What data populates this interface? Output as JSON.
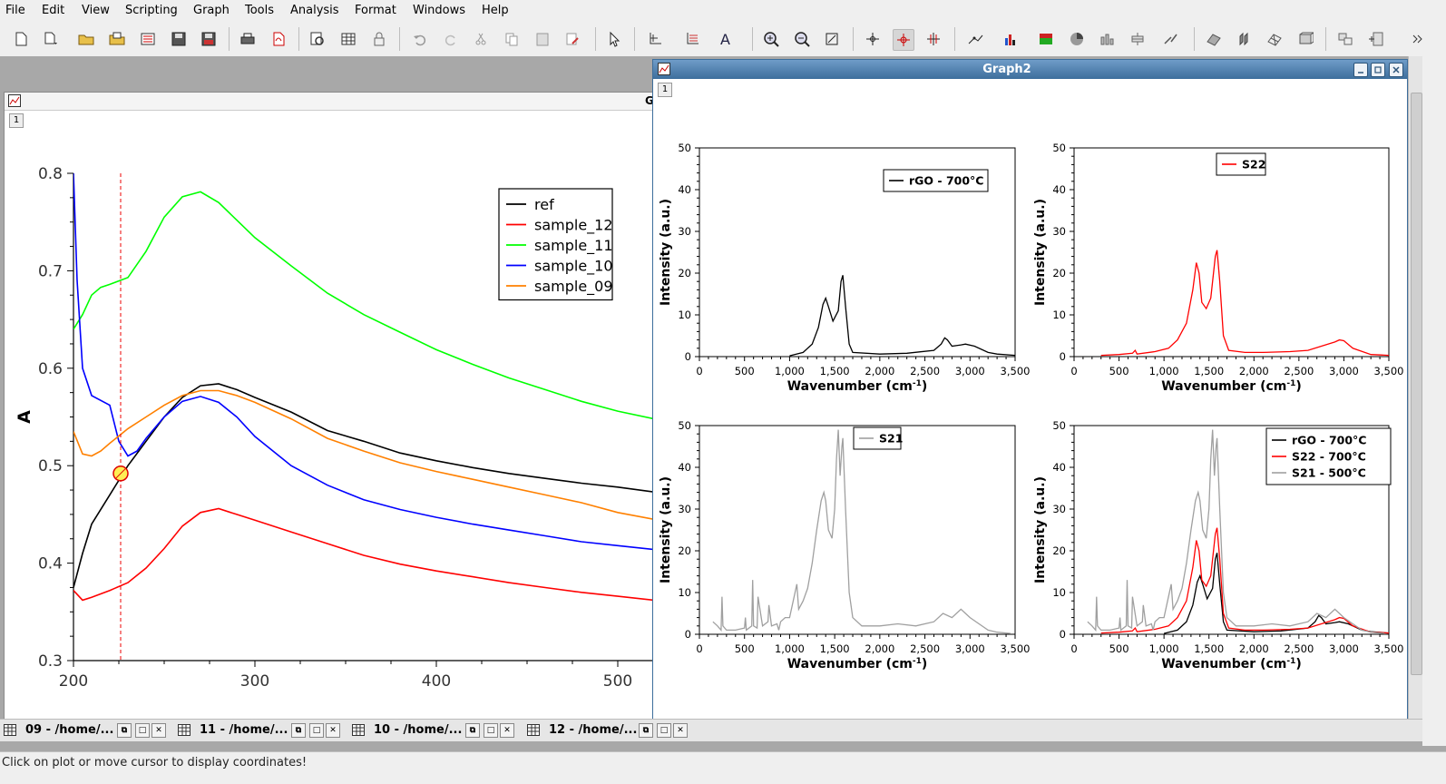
{
  "menu": [
    "File",
    "Edit",
    "View",
    "Scripting",
    "Graph",
    "Tools",
    "Analysis",
    "Format",
    "Windows",
    "Help"
  ],
  "toolbar": {
    "icons": [
      "new-project-icon",
      "new-dropdown-icon",
      "open-folder-icon",
      "open-template-icon",
      "import-ascii-icon",
      "save-icon",
      "save-as-icon",
      "print-icon",
      "export-pdf-icon",
      "preview-icon",
      "table-icon",
      "lock-icon",
      "undo-icon",
      "redo-icon",
      "cut-icon",
      "copy-icon",
      "paste-icon",
      "clear-icon",
      "pointer-icon",
      "axes-dropdown-icon",
      "grid-dropdown-icon",
      "text-dropdown-icon",
      "zoom-in-icon",
      "zoom-out-icon",
      "rescale-icon",
      "data-reader-icon",
      "screen-reader-icon",
      "data-range-icon",
      "line-style-dropdown-icon",
      "bar-chart-dropdown-icon",
      "image-plot-icon",
      "pie-icon",
      "3d-bars-icon",
      "box-plot-icon",
      "vector-dropdown-icon",
      "3d-surface-icon",
      "3d-ribbon-icon",
      "3d-wireframe-icon",
      "3d-scatter-icon",
      "arrange-layers-icon",
      "add-layer-icon"
    ]
  },
  "graph1": {
    "title_partial": "G",
    "layer": "1",
    "y_axis_label": "A",
    "chart_data": {
      "type": "line",
      "xlabel": "",
      "ylabel": "A",
      "xlim": [
        200,
        520
      ],
      "ylim": [
        0.3,
        0.8
      ],
      "x_ticks": [
        "200",
        "300",
        "400",
        "500"
      ],
      "y_ticks": [
        "0.3",
        "0.4",
        "0.5",
        "0.6",
        "0.7",
        "0.8"
      ],
      "legend_position": "top-right",
      "cursor_x": 226,
      "marker_point": [
        226,
        0.492
      ],
      "series": [
        {
          "name": "ref",
          "color": "#000000",
          "x": [
            200,
            205,
            210,
            220,
            230,
            240,
            250,
            260,
            270,
            280,
            290,
            300,
            320,
            340,
            360,
            380,
            400,
            420,
            440,
            460,
            480,
            500,
            520
          ],
          "y": [
            0.375,
            0.41,
            0.44,
            0.47,
            0.5,
            0.525,
            0.55,
            0.57,
            0.582,
            0.584,
            0.578,
            0.57,
            0.555,
            0.536,
            0.525,
            0.513,
            0.505,
            0.498,
            0.492,
            0.487,
            0.482,
            0.478,
            0.473
          ]
        },
        {
          "name": "sample_12",
          "color": "#ff0000",
          "x": [
            200,
            205,
            210,
            220,
            230,
            240,
            250,
            260,
            270,
            280,
            290,
            300,
            320,
            340,
            360,
            380,
            400,
            420,
            440,
            460,
            480,
            500,
            520
          ],
          "y": [
            0.372,
            0.362,
            0.365,
            0.372,
            0.38,
            0.395,
            0.415,
            0.438,
            0.452,
            0.456,
            0.45,
            0.444,
            0.432,
            0.42,
            0.408,
            0.399,
            0.392,
            0.386,
            0.38,
            0.375,
            0.37,
            0.366,
            0.362
          ]
        },
        {
          "name": "sample_11",
          "color": "#00ff00",
          "x": [
            200,
            205,
            210,
            215,
            220,
            230,
            240,
            250,
            260,
            270,
            280,
            290,
            300,
            320,
            340,
            360,
            380,
            400,
            420,
            440,
            460,
            480,
            500,
            520
          ],
          "y": [
            0.64,
            0.655,
            0.675,
            0.683,
            0.686,
            0.693,
            0.72,
            0.755,
            0.776,
            0.781,
            0.77,
            0.752,
            0.734,
            0.705,
            0.677,
            0.655,
            0.637,
            0.619,
            0.604,
            0.59,
            0.578,
            0.566,
            0.556,
            0.548
          ]
        },
        {
          "name": "sample_10",
          "color": "#0000ff",
          "x": [
            200,
            202,
            205,
            210,
            220,
            225,
            230,
            235,
            240,
            250,
            260,
            270,
            280,
            290,
            300,
            320,
            340,
            360,
            380,
            400,
            420,
            440,
            460,
            480,
            500,
            520
          ],
          "y": [
            0.8,
            0.69,
            0.6,
            0.572,
            0.562,
            0.525,
            0.51,
            0.515,
            0.528,
            0.55,
            0.566,
            0.571,
            0.565,
            0.55,
            0.53,
            0.5,
            0.48,
            0.465,
            0.455,
            0.447,
            0.44,
            0.434,
            0.428,
            0.422,
            0.418,
            0.414
          ]
        },
        {
          "name": "sample_09",
          "color": "#ff8000",
          "x": [
            200,
            205,
            210,
            215,
            220,
            230,
            240,
            250,
            260,
            270,
            280,
            290,
            300,
            320,
            340,
            360,
            380,
            400,
            420,
            440,
            460,
            480,
            500,
            520
          ],
          "y": [
            0.535,
            0.512,
            0.51,
            0.515,
            0.523,
            0.538,
            0.55,
            0.562,
            0.572,
            0.577,
            0.577,
            0.572,
            0.565,
            0.548,
            0.528,
            0.515,
            0.503,
            0.494,
            0.486,
            0.478,
            0.47,
            0.462,
            0.452,
            0.445
          ]
        }
      ]
    }
  },
  "graph2": {
    "title": "Graph2",
    "layer": "1",
    "chart_data": [
      {
        "type": "line",
        "xlabel": "Wavenumber",
        "xlabel_unit": "(cm",
        "xlabel_sup": "-1",
        "xlabel_tail": ")",
        "ylabel": "Intensity (a.u.)",
        "xlim": [
          0,
          3500
        ],
        "ylim": [
          0,
          50
        ],
        "x_ticks": [
          "0",
          "500",
          "1,000",
          "1,500",
          "2,000",
          "2,500",
          "3,000",
          "3,500"
        ],
        "y_ticks": [
          "0",
          "10",
          "20",
          "30",
          "40",
          "50"
        ],
        "legend_position": "top-right",
        "series": [
          {
            "name": "rGO - 700°C",
            "color": "#000000",
            "x": [
              1000,
              1150,
              1250,
              1320,
              1370,
              1400,
              1430,
              1480,
              1540,
              1570,
              1590,
              1620,
              1660,
              1700,
              2000,
              2300,
              2600,
              2680,
              2720,
              2750,
              2800,
              2900,
              2950,
              3050,
              3200,
              3300,
              3500
            ],
            "y": [
              0.2,
              1,
              3,
              7,
              12.5,
              14,
              12,
              8.5,
              11,
              18,
              19.5,
              12,
              3,
              1,
              0.6,
              0.8,
              1.5,
              3,
              4.5,
              4,
              2.5,
              2.8,
              3,
              2.5,
              1,
              0.6,
              0.3
            ]
          }
        ]
      },
      {
        "type": "line",
        "xlabel": "Wavenumber",
        "xlabel_unit": "(cm",
        "xlabel_sup": "-1",
        "xlabel_tail": ")",
        "ylabel": "Intensity (a.u.)",
        "xlim": [
          0,
          3500
        ],
        "ylim": [
          0,
          50
        ],
        "x_ticks": [
          "0",
          "500",
          "1,000",
          "1,500",
          "2,000",
          "2,500",
          "3,000",
          "3,500"
        ],
        "y_ticks": [
          "0",
          "10",
          "20",
          "30",
          "40",
          "50"
        ],
        "legend_position": "top-center",
        "series": [
          {
            "name": "S22",
            "color": "#ff0000",
            "x": [
              300,
              500,
              650,
              680,
              700,
              900,
              1050,
              1150,
              1250,
              1320,
              1360,
              1390,
              1420,
              1470,
              1520,
              1570,
              1590,
              1620,
              1660,
              1720,
              1900,
              2100,
              2400,
              2600,
              2750,
              2900,
              2950,
              3000,
              3100,
              3300,
              3500
            ],
            "y": [
              0.3,
              0.5,
              0.8,
              1.5,
              0.6,
              1.2,
              2,
              4,
              8,
              16,
              22.5,
              20,
              13,
              11.5,
              14,
              24,
              25.5,
              18,
              5,
              1.5,
              1,
              1,
              1.2,
              1.5,
              2.5,
              3.5,
              4,
              3.8,
              2,
              0.5,
              0.3
            ]
          }
        ]
      },
      {
        "type": "line",
        "xlabel": "Wavenumber",
        "xlabel_unit": "(cm",
        "xlabel_sup": "-1",
        "xlabel_tail": ")",
        "ylabel": "Intensity (a.u.)",
        "xlim": [
          0,
          3500
        ],
        "ylim": [
          0,
          50
        ],
        "x_ticks": [
          "0",
          "500",
          "1,000",
          "1,500",
          "2,000",
          "2,500",
          "3,000",
          "3,500"
        ],
        "y_ticks": [
          "0",
          "10",
          "20",
          "30",
          "40",
          "50"
        ],
        "legend_position": "top-left",
        "series": [
          {
            "name": "S21",
            "color": "#a0a0a0",
            "x": [
              150,
              200,
              240,
              250,
              260,
              300,
              400,
              500,
              510,
              520,
              580,
              590,
              600,
              640,
              650,
              700,
              760,
              770,
              800,
              860,
              880,
              900,
              950,
              1000,
              1080,
              1100,
              1150,
              1200,
              1250,
              1300,
              1350,
              1380,
              1400,
              1430,
              1470,
              1500,
              1520,
              1540,
              1560,
              1580,
              1590,
              1620,
              1660,
              1700,
              1800,
              2000,
              2200,
              2400,
              2600,
              2700,
              2800,
              2900,
              2950,
              3000,
              3100,
              3200,
              3300,
              3400,
              3450
            ],
            "y": [
              3,
              2,
              1,
              9,
              2,
              1,
              1,
              1.5,
              4,
              1,
              2,
              13,
              2,
              1.5,
              9,
              2,
              3,
              7,
              2,
              2.5,
              1,
              3,
              4,
              4,
              12,
              6,
              8,
              11,
              17,
              25,
              32,
              34,
              32,
              25,
              23,
              30,
              42,
              49,
              38,
              45,
              47,
              30,
              10,
              4,
              2,
              2,
              2.5,
              2,
              3,
              5,
              4,
              6,
              5,
              4,
              2.5,
              1,
              0.5,
              0.3,
              0.2
            ]
          }
        ]
      },
      {
        "type": "line",
        "xlabel": "Wavenumber",
        "xlabel_unit": "(cm",
        "xlabel_sup": "-1",
        "xlabel_tail": ")",
        "ylabel": "Intensity (a.u.)",
        "xlim": [
          0,
          3500
        ],
        "ylim": [
          0,
          50
        ],
        "x_ticks": [
          "0",
          "500",
          "1,000",
          "1,500",
          "2,000",
          "2,500",
          "3,000",
          "3,500"
        ],
        "y_ticks": [
          "0",
          "10",
          "20",
          "30",
          "40",
          "50"
        ],
        "legend_position": "top-right",
        "series": [
          {
            "name": "rGO - 700°C",
            "color": "#000000",
            "x": [
              1000,
              1150,
              1250,
              1320,
              1370,
              1400,
              1430,
              1480,
              1540,
              1570,
              1590,
              1620,
              1660,
              1700,
              2000,
              2300,
              2600,
              2680,
              2720,
              2750,
              2800,
              2900,
              2950,
              3050,
              3200,
              3300,
              3500
            ],
            "y": [
              0.2,
              1,
              3,
              7,
              12.5,
              14,
              12,
              8.5,
              11,
              18,
              19.5,
              12,
              3,
              1,
              0.6,
              0.8,
              1.5,
              3,
              4.5,
              4,
              2.5,
              2.8,
              3,
              2.5,
              1,
              0.6,
              0.3
            ]
          },
          {
            "name": "S22 - 700°C",
            "color": "#ff0000",
            "x": [
              300,
              500,
              650,
              680,
              700,
              900,
              1050,
              1150,
              1250,
              1320,
              1360,
              1390,
              1420,
              1470,
              1520,
              1570,
              1590,
              1620,
              1660,
              1720,
              1900,
              2100,
              2400,
              2600,
              2750,
              2900,
              2950,
              3000,
              3100,
              3300,
              3500
            ],
            "y": [
              0.3,
              0.5,
              0.8,
              1.5,
              0.6,
              1.2,
              2,
              4,
              8,
              16,
              22.5,
              20,
              13,
              11.5,
              14,
              24,
              25.5,
              18,
              5,
              1.5,
              1,
              1,
              1.2,
              1.5,
              2.5,
              3.5,
              4,
              3.8,
              2,
              0.5,
              0.3
            ]
          },
          {
            "name": "S21 - 500°C",
            "color": "#a0a0a0",
            "x": [
              150,
              200,
              240,
              250,
              260,
              300,
              400,
              500,
              510,
              520,
              580,
              590,
              600,
              640,
              650,
              700,
              760,
              770,
              800,
              860,
              880,
              900,
              950,
              1000,
              1080,
              1100,
              1150,
              1200,
              1250,
              1300,
              1350,
              1380,
              1400,
              1430,
              1470,
              1500,
              1520,
              1540,
              1560,
              1580,
              1590,
              1620,
              1660,
              1700,
              1800,
              2000,
              2200,
              2400,
              2600,
              2700,
              2800,
              2900,
              2950,
              3000,
              3100,
              3200,
              3300,
              3400,
              3450
            ],
            "y": [
              3,
              2,
              1,
              9,
              2,
              1,
              1,
              1.5,
              4,
              1,
              2,
              13,
              2,
              1.5,
              9,
              2,
              3,
              7,
              2,
              2.5,
              1,
              3,
              4,
              4,
              12,
              6,
              8,
              11,
              17,
              25,
              32,
              34,
              32,
              25,
              23,
              30,
              42,
              49,
              38,
              45,
              47,
              30,
              10,
              4,
              2,
              2,
              2.5,
              2,
              3,
              5,
              4,
              6,
              5,
              4,
              2.5,
              1,
              0.5,
              0.3,
              0.2
            ]
          }
        ]
      }
    ]
  },
  "taskbar": [
    {
      "label": "09 - /home/..."
    },
    {
      "label": "11 - /home/..."
    },
    {
      "label": "10 - /home/..."
    },
    {
      "label": "12 - /home/..."
    }
  ],
  "status": "Click on plot or move cursor to display coordinates!"
}
